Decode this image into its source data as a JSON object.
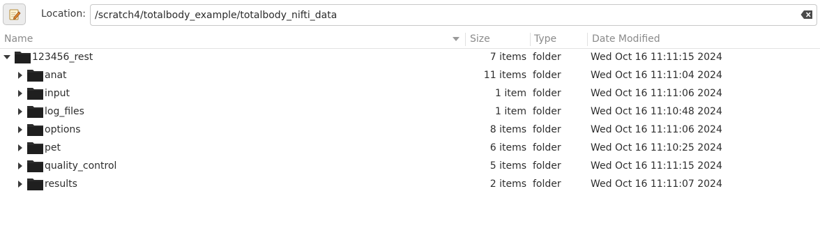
{
  "toolbar": {
    "edit_icon": "pencil-notepad-icon",
    "location_label": "Location:",
    "location_value": "/scratch4/totalbody_example/totalbody_nifti_data",
    "clear_icon": "backspace-clear-icon"
  },
  "columns": {
    "name": "Name",
    "size": "Size",
    "type": "Type",
    "date_modified": "Date Modified"
  },
  "rows": [
    {
      "name": "123456_rest",
      "size": "7 items",
      "type": "folder",
      "date": "Wed Oct 16 11:11:15 2024",
      "level": 0,
      "expanded": true
    },
    {
      "name": "anat",
      "size": "11 items",
      "type": "folder",
      "date": "Wed Oct 16 11:11:04 2024",
      "level": 1,
      "expanded": false
    },
    {
      "name": "input",
      "size": "1 item",
      "type": "folder",
      "date": "Wed Oct 16 11:11:06 2024",
      "level": 1,
      "expanded": false
    },
    {
      "name": "log_files",
      "size": "1 item",
      "type": "folder",
      "date": "Wed Oct 16 11:10:48 2024",
      "level": 1,
      "expanded": false
    },
    {
      "name": "options",
      "size": "8 items",
      "type": "folder",
      "date": "Wed Oct 16 11:11:06 2024",
      "level": 1,
      "expanded": false
    },
    {
      "name": "pet",
      "size": "6 items",
      "type": "folder",
      "date": "Wed Oct 16 11:10:25 2024",
      "level": 1,
      "expanded": false
    },
    {
      "name": "quality_control",
      "size": "5 items",
      "type": "folder",
      "date": "Wed Oct 16 11:11:15 2024",
      "level": 1,
      "expanded": false
    },
    {
      "name": "results",
      "size": "2 items",
      "type": "folder",
      "date": "Wed Oct 16 11:11:07 2024",
      "level": 1,
      "expanded": false
    }
  ]
}
